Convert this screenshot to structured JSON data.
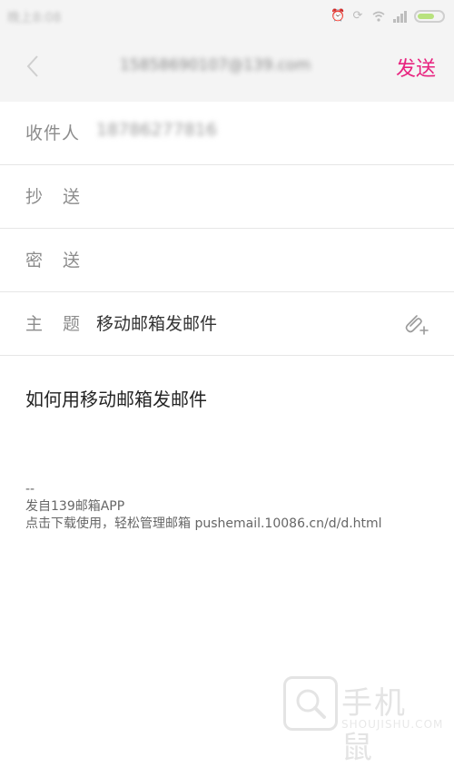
{
  "status_bar": {
    "time": "晚上8:08",
    "icons": [
      "alarm-icon",
      "rotation-lock-icon",
      "wifi-icon",
      "signal-icon",
      "battery-icon"
    ]
  },
  "nav": {
    "title": "15858690107@139.com",
    "send_label": "发送",
    "accent_color": "#e8237f"
  },
  "form": {
    "to_label": "收件人",
    "to_value": "18786277816",
    "cc_label": "抄送",
    "bcc_label": "密送",
    "subject_label": "主题",
    "subject_value": "移动邮箱发邮件"
  },
  "body": {
    "text": "如何用移动邮箱发邮件",
    "signature_sep": "--",
    "signature_line1": "发自139邮箱APP",
    "signature_line2": "点击下载使用，轻松管理邮箱 pushemail.10086.cn/d/d.html"
  },
  "watermark": {
    "text": "手机鼠",
    "subtext": "SHOUJISHU.COM"
  }
}
